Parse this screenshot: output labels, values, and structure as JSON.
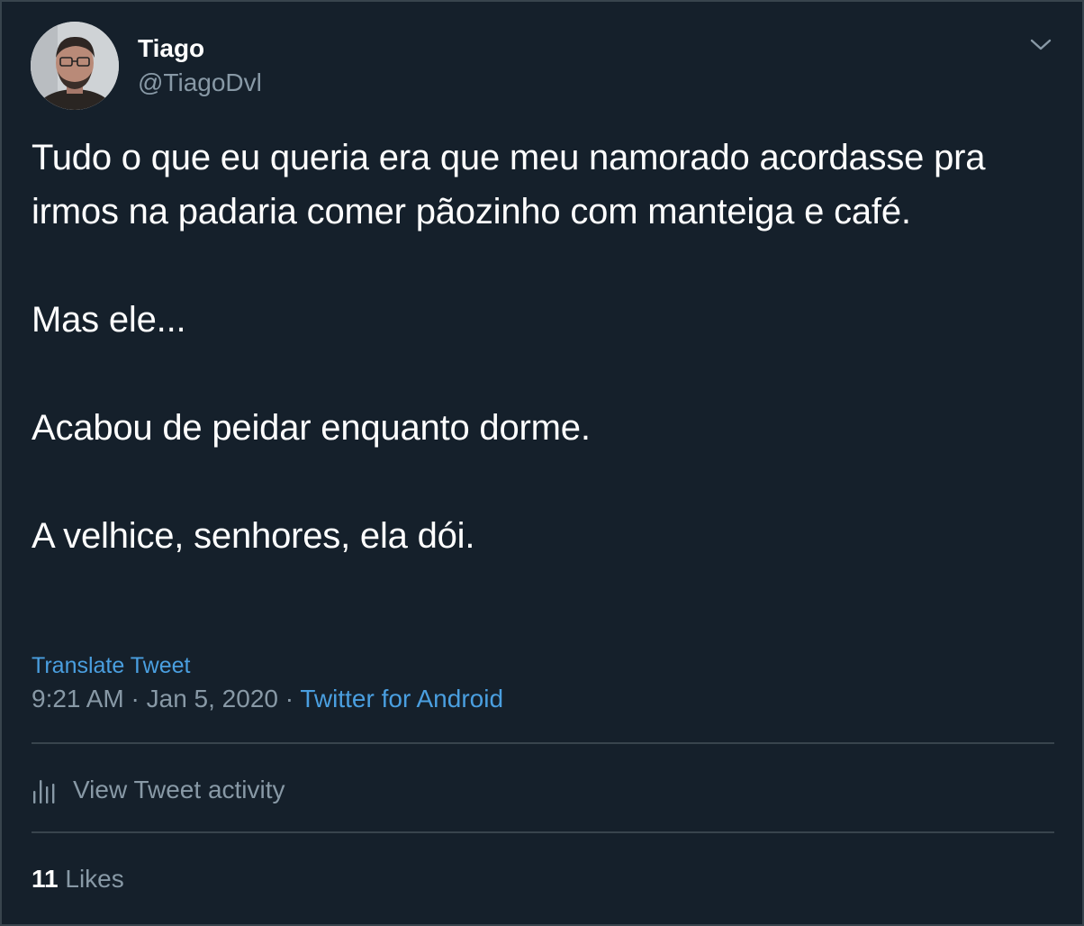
{
  "author": {
    "display_name": "Tiago",
    "handle": "@TiagoDvl"
  },
  "tweet": {
    "paragraphs": [
      "Tudo o que eu queria era que meu namorado acordasse pra irmos na padaria comer pãozinho com manteiga e café.",
      "Mas ele...",
      "Acabou de peidar enquanto dorme.",
      "A velhice, senhores, ela dói."
    ],
    "translate_label": "Translate Tweet",
    "time": "9:21 AM",
    "date": "Jan 5, 2020",
    "separator": "·",
    "source": "Twitter for Android"
  },
  "activity": {
    "label": "View Tweet activity",
    "icon": "bar-chart-icon"
  },
  "stats": {
    "likes_count": "11",
    "likes_label": "Likes"
  },
  "menu": {
    "icon": "chevron-down-icon"
  },
  "colors": {
    "background": "#15202b",
    "border": "#38444d",
    "primary_text": "#ffffff",
    "secondary_text": "#8899a6",
    "link": "#4a9fe0"
  }
}
